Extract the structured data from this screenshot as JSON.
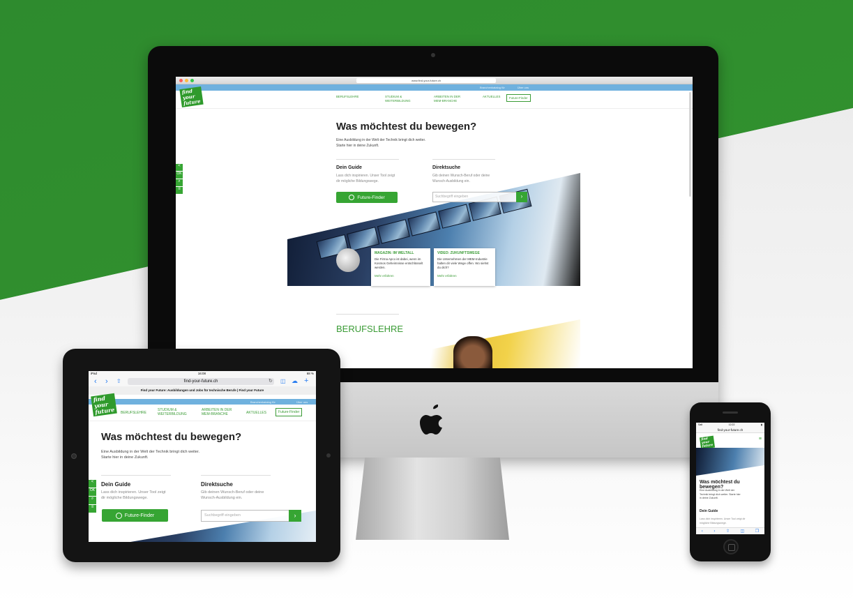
{
  "colors": {
    "brand_green": "#36a533",
    "top_band_blue": "#6fb1de",
    "backdrop_green": "#34962f"
  },
  "logo": {
    "line1": "find",
    "line2": "your",
    "line3": "future"
  },
  "desktop": {
    "url": "www.find-your-future.ch",
    "top_links": [
      "Branchenkatalog für",
      "Über uns"
    ],
    "nav": [
      "BERUFSLEHRE",
      "STUDIUM & WEITERBILDUNG",
      "ARBEITEN IN DER MEM-BRANCHE",
      "AKTUELLES"
    ],
    "future_finder_link": "Future-Finder",
    "hero_title": "Was möchtest du bewegen?",
    "hero_sub1": "Eine Ausbildung in der Welt der Technik bringt dich weiter.",
    "hero_sub2": "Starte hier in deine Zukunft.",
    "guide_title": "Dein Guide",
    "guide_text1": "Lass dich inspirieren. Unser Tool zeigt",
    "guide_text2": "dir mögliche Bildungswege.",
    "guide_button": "Future-Finder",
    "search_title": "Direktsuche",
    "search_text1": "Gib deinen Wunsch-Beruf oder deine",
    "search_text2": "Wunsch-Ausbildung ein.",
    "search_placeholder": "Suchbegriff eingeben",
    "search_go": "›",
    "card1": {
      "title": "MAGAZIN: IM WELTALL",
      "text": "Die Firma Apco ist dabei, wenn im Kosmos Geheimnisse entschlüsselt werden.",
      "link": "Mehr erfahren"
    },
    "card2": {
      "title": "VIDEO: ZUKUNFTSWEGE",
      "text": "Die Unternehmen der MEM-Industrie halten dir viele Wege offen. Wo siehst du dich?",
      "link": "Mehr erfahren"
    },
    "section_title": "BERUFSLEHRE"
  },
  "tablet": {
    "status_left": "iPad",
    "status_time": "16:08",
    "status_right": "68 %",
    "url": "find-your-future.ch",
    "page_title": "Find your Future: Ausbildungen und Jobs für technische Berufe | Find your Future",
    "top_links": [
      "Branchenkatalog für",
      "Über uns"
    ],
    "nav": [
      "BERUFSLEHRE",
      "STUDIUM & WEITERBILDUNG",
      "ARBEITEN IN DER MEM-BRANCHE",
      "AKTUELLES"
    ],
    "future_finder_link": "Future-Finder",
    "hero_title": "Was möchtest du bewegen?",
    "hero_sub1": "Eine Ausbildung in der Welt der Technik bringt dich weiter.",
    "hero_sub2": "Starte hier in deine Zukunft.",
    "guide_title": "Dein Guide",
    "guide_text1": "Lass dich inspirieren. Unser Tool zeigt",
    "guide_text2": "dir mögliche Bildungswege.",
    "guide_button": "Future-Finder",
    "search_title": "Direktsuche",
    "search_text1": "Gib deinen Wunsch-Beruf oder deine",
    "search_text2": "Wunsch-Ausbildung ein.",
    "search_placeholder": "Suchbegriff eingeben",
    "search_go": "›"
  },
  "phone": {
    "status_left": "Salt",
    "status_time": "12:22",
    "url": "find-your-future.ch",
    "hero_title": "Was möchtest du bewegen?",
    "hero_sub": "Eine Ausbildung in der Welt der Technik bringt dich weiter. Starte hier in deine Zukunft.",
    "guide_title": "Dein Guide",
    "guide_text": "Lass dich inspirieren. Unser Tool zeigt dir mögliche Bildungswege."
  }
}
